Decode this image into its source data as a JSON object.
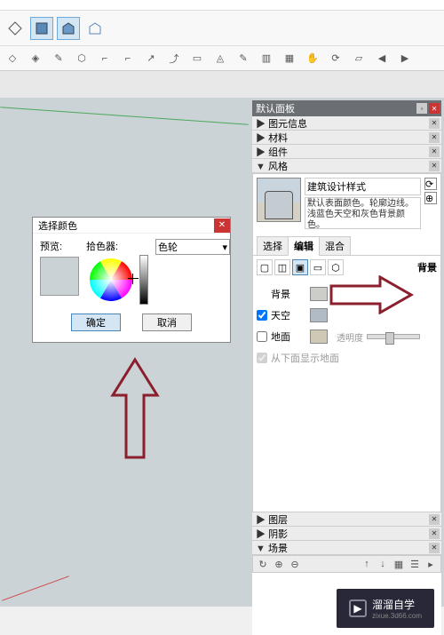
{
  "color_dialog": {
    "title": "选择颜色",
    "preview_label": "预览:",
    "picker_label": "拾色器:",
    "picker_type": "色轮",
    "ok": "确定",
    "cancel": "取消",
    "preview_color": "#cad2d5"
  },
  "panels": {
    "header": "默认面板",
    "entity_info": "图元信息",
    "material": "材料",
    "component": "组件",
    "style": "风格",
    "layer": "图层",
    "shadow": "阴影",
    "scene": "场景"
  },
  "style_panel": {
    "name": "建筑设计样式",
    "desc": "默认表面颜色。轮廓边线。浅蓝色天空和灰色背景颜色。",
    "tabs": {
      "select": "选择",
      "edit": "编辑",
      "mix": "混合"
    },
    "bg_heading": "背景",
    "rows": {
      "background": "背景",
      "sky": "天空",
      "ground": "地面",
      "show_ground": "从下面显示地面",
      "transparency": "透明度"
    },
    "colors": {
      "background": "#ccccc8",
      "sky": "#b0bbc6",
      "ground": "#cec8b5"
    }
  },
  "watermark": {
    "text": "溜溜自学",
    "url": "zixue.3d66.com"
  }
}
